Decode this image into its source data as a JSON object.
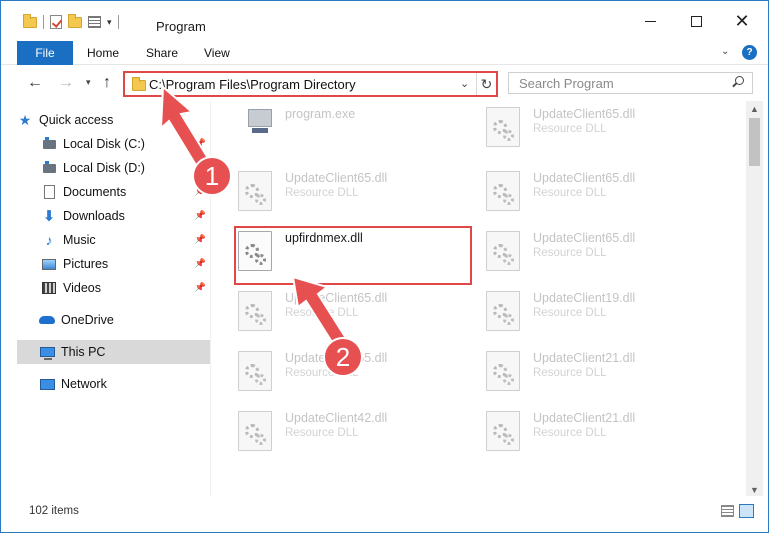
{
  "window": {
    "title": "Program",
    "minimize_icon": "minimize-icon",
    "maximize_icon": "maximize-icon",
    "close_icon": "close-icon"
  },
  "ribbon": {
    "tabs": [
      "File",
      "Home",
      "Share",
      "View"
    ],
    "active_tab": "File",
    "help_glyph": "?"
  },
  "address": {
    "path": "C:\\Program Files\\Program Directory"
  },
  "search": {
    "placeholder": "Search Program"
  },
  "sidebar": {
    "items": [
      {
        "label": "Quick access",
        "icon": "star-icon",
        "pinned": false
      },
      {
        "label": "Local Disk (C:)",
        "icon": "disk-icon",
        "pinned": true
      },
      {
        "label": "Local Disk (D:)",
        "icon": "disk-icon",
        "pinned": false
      },
      {
        "label": "Documents",
        "icon": "documents-icon",
        "pinned": true
      },
      {
        "label": "Downloads",
        "icon": "downloads-icon",
        "pinned": true
      },
      {
        "label": "Music",
        "icon": "music-icon",
        "pinned": true
      },
      {
        "label": "Pictures",
        "icon": "pictures-icon",
        "pinned": true
      },
      {
        "label": "Videos",
        "icon": "videos-icon",
        "pinned": true
      },
      {
        "label": "OneDrive",
        "icon": "onedrive-icon",
        "pinned": false
      },
      {
        "label": "This PC",
        "icon": "this-pc-icon",
        "pinned": false,
        "selected": true
      },
      {
        "label": "Network",
        "icon": "network-icon",
        "pinned": false
      }
    ]
  },
  "files": [
    {
      "name": "program.exe",
      "type": "",
      "focused": false,
      "icon": "exe-icon"
    },
    {
      "name": "UpdateClient65.dll",
      "type": "Resource DLL",
      "focused": false,
      "icon": "dll-icon"
    },
    {
      "name": "UpdateClient65.dll",
      "type": "Resource DLL",
      "focused": false,
      "icon": "dll-icon"
    },
    {
      "name": "UpdateClient65.dll",
      "type": "Resource DLL",
      "focused": false,
      "icon": "dll-icon"
    },
    {
      "name": "upfirdnmex.dll",
      "type": "",
      "focused": true,
      "icon": "dll-icon"
    },
    {
      "name": "UpdateClient65.dll",
      "type": "Resource DLL",
      "focused": false,
      "icon": "dll-icon"
    },
    {
      "name": "UpdateClient65.dll",
      "type": "Resource DLL",
      "focused": false,
      "icon": "dll-icon"
    },
    {
      "name": "UpdateClient19.dll",
      "type": "Resource DLL",
      "focused": false,
      "icon": "dll-icon"
    },
    {
      "name": "UpdateClient65.dll",
      "type": "Resource DLL",
      "focused": false,
      "icon": "dll-icon"
    },
    {
      "name": "UpdateClient21.dll",
      "type": "Resource DLL",
      "focused": false,
      "icon": "dll-icon"
    },
    {
      "name": "UpdateClient42.dll",
      "type": "Resource DLL",
      "focused": false,
      "icon": "dll-icon"
    },
    {
      "name": "UpdateClient21.dll",
      "type": "Resource DLL",
      "focused": false,
      "icon": "dll-icon"
    }
  ],
  "status": {
    "item_count": "102 items"
  },
  "annotations": [
    {
      "number": "1"
    },
    {
      "number": "2"
    }
  ],
  "colors": {
    "accent": "#1a6fc2",
    "highlight": "#e04848",
    "arrow": "#e65050"
  }
}
